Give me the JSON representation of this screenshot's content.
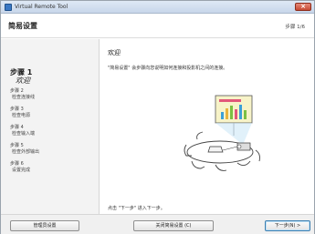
{
  "window": {
    "title": "Virtual Remote Tool"
  },
  "header": {
    "title": "简易设置",
    "step_counter": "步骤 1/6"
  },
  "sidebar": {
    "items": [
      {
        "step": "步骤 1",
        "name": "欢迎",
        "active": true
      },
      {
        "step": "步骤 2",
        "name": "检查连接线"
      },
      {
        "step": "步骤 3",
        "name": "检查电源"
      },
      {
        "step": "步骤 4",
        "name": "检查输入端"
      },
      {
        "step": "步骤 5",
        "name": "检查外部输出"
      },
      {
        "step": "步骤 6",
        "name": "设置完成"
      }
    ]
  },
  "main": {
    "heading": "欢迎",
    "intro": "\"简易设置\" 会步骤向您说明如何连接和投影机之间的连接。",
    "illustration_icon": "projector-meeting-illustration",
    "hint": "点击 \"下一步\" 进入下一步。"
  },
  "footer": {
    "admin_label": "管理员设置",
    "close_label": "关闭简易设置 (C)",
    "next_label": "下一步(N) >"
  },
  "colors": {
    "chart_bars": [
      "#3ba0d8",
      "#e8b43c",
      "#7bc043",
      "#e2577a"
    ],
    "screen": "#f7f3c8"
  }
}
